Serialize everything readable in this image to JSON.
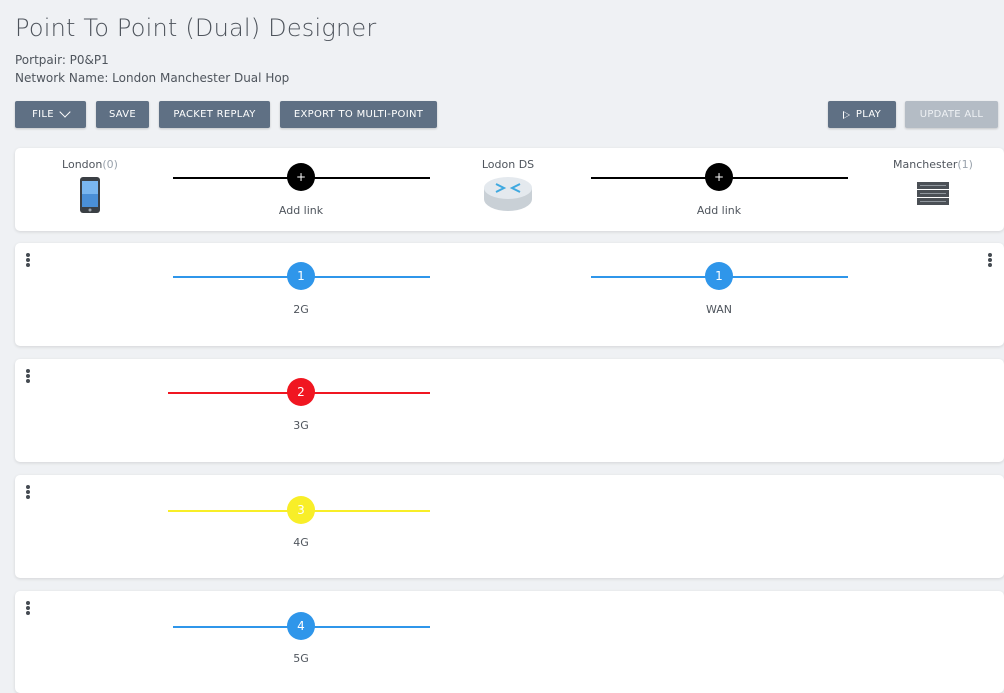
{
  "header": {
    "title": "Point To Point (Dual) Designer",
    "portpair": "Portpair: P0&P1",
    "network_name": "Network Name: London Manchester Dual Hop"
  },
  "toolbar": {
    "file_label": "FILE",
    "save_label": "SAVE",
    "packet_replay_label": "PACKET REPLAY",
    "export_label": "EXPORT TO MULTI-POINT",
    "play_label": "PLAY",
    "update_all_label": "UPDATE ALL"
  },
  "topology": {
    "nodes": [
      {
        "name": "London",
        "count": "(0)",
        "icon": "phone-icon"
      },
      {
        "name": "Lodon DS",
        "count": "",
        "icon": "router-icon"
      },
      {
        "name": "Manchester",
        "count": "(1)",
        "icon": "server-icon"
      }
    ],
    "add_link_left": {
      "symbol": "+",
      "label": "Add link"
    },
    "add_link_right": {
      "symbol": "+",
      "label": "Add link"
    }
  },
  "link_rows": [
    {
      "left": {
        "number": "1",
        "label": "2G",
        "color": "#2f96ea"
      },
      "right": {
        "number": "1",
        "label": "WAN",
        "color": "#2f96ea"
      }
    },
    {
      "left": {
        "number": "2",
        "label": "3G",
        "color": "#f01621"
      }
    },
    {
      "left": {
        "number": "3",
        "label": "4G",
        "color": "#f8ee28"
      }
    },
    {
      "left": {
        "number": "4",
        "label": "5G",
        "color": "#2f96ea"
      }
    }
  ],
  "colors": {
    "button": "#5f7084",
    "button_disabled": "#b4bcc5",
    "blue": "#2f96ea",
    "red": "#f01621",
    "yellow": "#f8ee28"
  }
}
